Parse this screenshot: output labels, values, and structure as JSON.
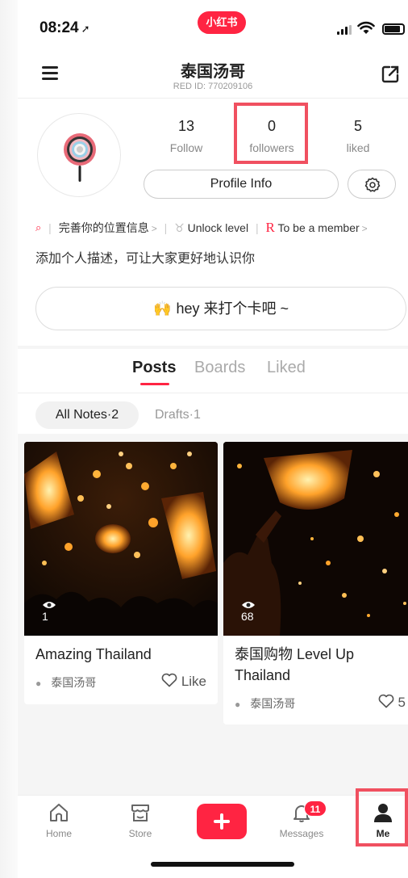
{
  "status_bar": {
    "time": "08:24",
    "location_arrow": "➚",
    "app_badge": "小红书"
  },
  "header": {
    "name": "泰国汤哥",
    "red_id": "RED ID: 770209106"
  },
  "stats": [
    {
      "value": "13",
      "label": "Follow"
    },
    {
      "value": "0",
      "label": "followers"
    },
    {
      "value": "5",
      "label": "liked"
    }
  ],
  "profile_button": "Profile Info",
  "info_row": {
    "location_label": "完善你的位置信息",
    "level_label": "Unlock level",
    "member_label": "To be a member"
  },
  "description": "添加个人描述，可让大家更好地认识你",
  "checkin": {
    "emoji": "🙌",
    "label": "hey 来打个卡吧 ~"
  },
  "tabs": [
    "Posts",
    "Boards",
    "Liked"
  ],
  "filters": {
    "all_notes": "All Notes·2",
    "drafts": "Drafts·1"
  },
  "posts": [
    {
      "views": "1",
      "title": "Amazing Thailand",
      "author": "泰国汤哥",
      "likes": "Like"
    },
    {
      "views": "68",
      "title": "泰国购物 Level Up Thailand",
      "author": "泰国汤哥",
      "likes": "5"
    }
  ],
  "bottom_nav": {
    "home": "Home",
    "store": "Store",
    "messages": "Messages",
    "messages_badge": "11",
    "me": "Me"
  },
  "colors": {
    "accent": "#ff2442",
    "highlight": "#f05060"
  }
}
